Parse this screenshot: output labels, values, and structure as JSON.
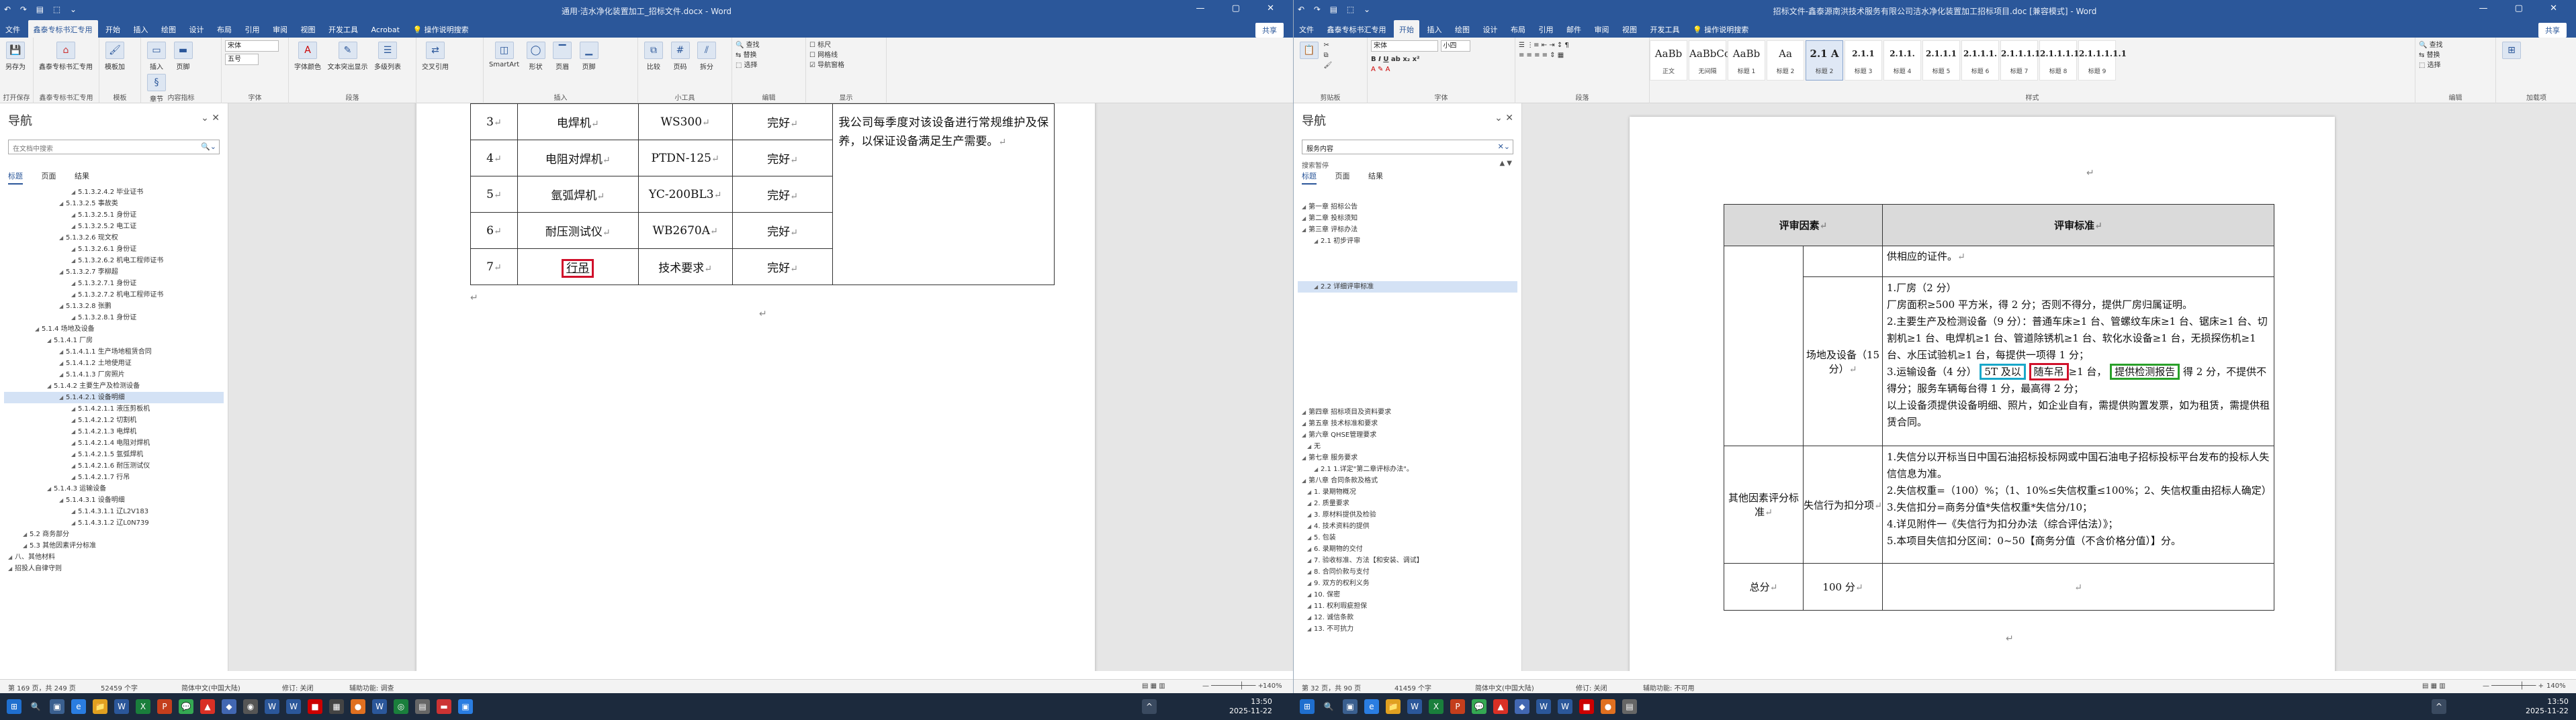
{
  "left": {
    "title": "通用·洁水净化装置加工_招标文件.docx - Word",
    "qat": "↶ ↷ ▤ ⬚ ⌄",
    "tabs": [
      "文件",
      "鑫泰专标书汇专用",
      "开始",
      "插入",
      "绘图",
      "设计",
      "布局",
      "引用",
      "审阅",
      "视图",
      "开发工具",
      "Acrobat",
      "操作说明搜索"
    ],
    "share": "共享",
    "ribbon_groups": [
      "打开保存",
      "鑫泰专标书汇专用",
      "模板",
      "内容指标",
      "字体",
      "段落",
      "插入",
      "工具",
      "小工具",
      "编辑",
      "显示"
    ],
    "ribbon_buttons": [
      "另存为",
      "鑫泰专标书汇专用",
      "模板加",
      "插入",
      "页脚",
      "章节",
      "字体颜色",
      "文本突出显示",
      "多级列表",
      "交叉引用",
      "SmartArt",
      "形状",
      "页眉",
      "页脚",
      "比较",
      "页码",
      "拆分",
      "查找",
      "替换",
      "选择",
      "标尺",
      "网格线",
      "导航窗格"
    ],
    "font_name": "宋体",
    "font_size": "五号",
    "nav": {
      "title": "导航",
      "search_placeholder": "在文档中搜索",
      "tabs": [
        "标题",
        "页面",
        "结果"
      ],
      "tree": [
        "5.1.3.2.4.2 毕业证书",
        "5.1.3.2.5 事故类",
        "5.1.3.2.5.1 身份证",
        "5.1.3.2.5.2 电工证",
        "5.1.3.2.6 现文权",
        "5.1.3.2.6.1 身份证",
        "5.1.3.2.6.2 机电工程师证书",
        "5.1.3.2.7 李柳超",
        "5.1.3.2.7.1 身份证",
        "5.1.3.2.7.2 机电工程师证书",
        "5.1.3.2.8 张鹏",
        "5.1.3.2.8.1 身份证",
        "5.1.4 场地及设备",
        "5.1.4.1 厂房",
        "5.1.4.1.1 生产场地租赁合同",
        "5.1.4.1.2 土地使用证",
        "5.1.4.1.3 厂房照片",
        "5.1.4.2 主要生产及检测设备",
        "5.1.4.2.1 设备明细",
        "5.1.4.2.1.1 液压剪板机",
        "5.1.4.2.1.2 切割机",
        "5.1.4.2.1.3 电焊机",
        "5.1.4.2.1.4 电阻对焊机",
        "5.1.4.2.1.5 氩弧焊机",
        "5.1.4.2.1.6 耐压测试仪",
        "5.1.4.2.1.7 行吊",
        "5.1.4.3 运输设备",
        "5.1.4.3.1 设备明细",
        "5.1.4.3.1.1 辽L2V183",
        "5.1.4.3.1.2 辽L0N739",
        "5.2 商务部分",
        "5.3 其他因素评分标准",
        "八、其他材料",
        "招投人自律守则"
      ]
    },
    "table": {
      "rows": [
        {
          "no": "3",
          "name": "电焊机",
          "model": "WS300",
          "state": "完好"
        },
        {
          "no": "4",
          "name": "电阻对焊机",
          "model": "PTDN-125",
          "state": "完好"
        },
        {
          "no": "5",
          "name": "氩弧焊机",
          "model": "YC-200BL3",
          "state": "完好"
        },
        {
          "no": "6",
          "name": "耐压测试仪",
          "model": "WB2670A",
          "state": "完好"
        },
        {
          "no": "7",
          "name": "行吊",
          "model": "技术要求",
          "state": "完好"
        }
      ],
      "note": "我公司每季度对该设备进行常规维护及保养，以保证设备满足生产需要。"
    },
    "status": {
      "page": "第 169 页，共 249 页",
      "words": "52459 个字",
      "lang": "简体中文(中国大陆)",
      "track": "修订: 关闭",
      "access": "辅助功能: 调查",
      "zoom": "140%"
    }
  },
  "right": {
    "title": "招标文件-鑫泰源南洪技术服务有限公司洁水净化装置加工招标项目.doc [兼容模式] - Word",
    "tabs": [
      "文件",
      "鑫泰专标书汇专用",
      "开始",
      "插入",
      "绘图",
      "设计",
      "布局",
      "引用",
      "邮件",
      "审阅",
      "视图",
      "开发工具",
      "操作说明搜索"
    ],
    "share": "共享",
    "ribbon_groups": [
      "剪贴板",
      "字体",
      "段落",
      "样式",
      "编辑",
      "加载项"
    ],
    "styles": [
      {
        "preview": "AaBb",
        "name": "正文"
      },
      {
        "preview": "AaBbCc",
        "name": "无间隔"
      },
      {
        "preview": "AaBb",
        "name": "标题 1"
      },
      {
        "preview": "Aa",
        "name": "标题 2"
      },
      {
        "preview": "2.1 A",
        "name": "标题 2"
      },
      {
        "preview": "2.1.1",
        "name": "标题 3"
      },
      {
        "preview": "2.1.1.",
        "name": "标题 4"
      },
      {
        "preview": "2.1.1.1",
        "name": "标题 5"
      },
      {
        "preview": "2.1.1.1.",
        "name": "标题 6"
      },
      {
        "preview": "2.1.1.1.1",
        "name": "标题 7"
      },
      {
        "preview": "2.1.1.1.1.",
        "name": "标题 8"
      },
      {
        "preview": "2.1.1.1.1.1",
        "name": "标题 9"
      }
    ],
    "font_name": "宋体",
    "font_size": "小四",
    "nav": {
      "title": "导航",
      "search_value": "服务内容",
      "hint": "搜索暂停",
      "tabs": [
        "标题",
        "页面",
        "结果"
      ],
      "tree": [
        "第一章 招标公告",
        "第二章 投标须知",
        "第三章 评标办法",
        "2.1 初步评审",
        "",
        "",
        "",
        "2.2 详细评审标准",
        "",
        "",
        "",
        "",
        "",
        "",
        "",
        "",
        "",
        "",
        "第四章 招标项目及资料要求",
        "第五章 技术标准和要求",
        "第六章 QHSE管理要求",
        "无",
        "第七章 服务要求",
        "2.1 1.详定\"第二章评标办法\"。",
        "第八章 合同条款及格式",
        "1. 录期物概况",
        "2. 质量要求",
        "3. 原材料提供及检验",
        "4. 技术资料的提供",
        "5. 包装",
        "6. 录期物的交付",
        "7. 验收标准、方法【和安装、调试】",
        "8. 合同价款与支付",
        "9. 双方的权利义务",
        "10. 保密",
        "11. 权利瑕疵担保",
        "12. 诚信条款",
        "13. 不可抗力"
      ]
    },
    "table": {
      "header_factor": "评审因素",
      "header_standard": "评审标准",
      "row0": "供相应的证件。",
      "site_factor": "场地及设备（15 分）",
      "site_lines": [
        "1.厂房（2 分）",
        "厂房面积≥500 平方米，得 2 分；否则不得分，提供厂房归属证明。",
        "2.主要生产及检测设备（9 分）：普通车床≥1 台、管螺纹车床≥1 台、锯床≥1 台、切割机≥1 台、电焊机≥1 台、管道除锈机≥1 台、软化水设备≥1 台，无损探伤机≥1 台、水压试验机≥1 台，每提供一项得 1 分；"
      ],
      "site_l4_a": "3.运输设备（4 分）",
      "site_l4_cyan": "5T 及以",
      "site_l4_red": "随车吊",
      "site_l4_b": "≥1 台，",
      "site_l4_green": "提供检测报告",
      "site_l4_c": "得 2 分，不提供不得分；服务车辆每台得 1 分，最高得 2 分；",
      "site_lines2": [
        "以上设备须提供设备明细、照片，如企业自有，需提供购置发票，如为租赁，需提供租赁合同。"
      ],
      "other_factor": "其他因素评分标准",
      "credit_factor": "失信行为扣分项",
      "credit_lines": [
        "1.失信分以开标当日中国石油招标投标网或中国石油电子招标投标平台发布的投标人失信信息为准。",
        "2.失信权重=（100）%；（1、10%≤失信权重≤100%；2、失信权重由招标人确定）",
        "3.失信扣分=商务分值*失信权重*失信分/10；",
        "4.详见附件一《失信行为扣分办法（综合评估法）》；",
        "5.本项目失信扣分区间：0~50【商务分值（不含价格分值）】分。"
      ],
      "total_label": "总分",
      "total_value": "100 分"
    },
    "status": {
      "page": "第 32 页，共 90 页",
      "words": "41459 个字",
      "lang": "简体中文(中国大陆)",
      "track": "修订: 关闭",
      "access": "辅助功能: 不可用",
      "zoom": "140%"
    }
  },
  "taskbar": {
    "time_left": "13:50",
    "date_left": "2025-11-22",
    "time_right": "13:50",
    "date_right": "2025-11-22"
  },
  "colors": {
    "word_blue": "#2b579a",
    "red_box": "#d0102a",
    "cyan_box": "#19a7c9",
    "green_box": "#2aa02a"
  }
}
